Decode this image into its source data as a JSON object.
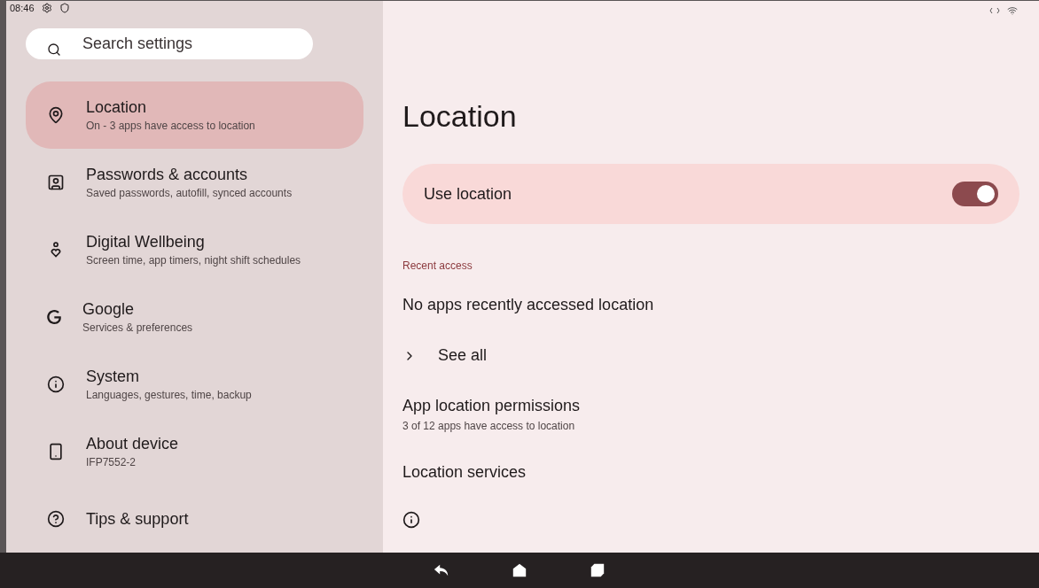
{
  "status_bar": {
    "time": "08:46"
  },
  "search": {
    "placeholder": "Search settings"
  },
  "sidebar": {
    "items": [
      {
        "kind": "location",
        "title": "Location",
        "subtitle": "On - 3 apps have access to location",
        "selected": true
      },
      {
        "kind": "account",
        "title": "Passwords & accounts",
        "subtitle": "Saved passwords, autofill, synced accounts",
        "selected": false
      },
      {
        "kind": "wellbeing",
        "title": "Digital Wellbeing",
        "subtitle": "Screen time, app timers, night shift schedules",
        "selected": false
      },
      {
        "kind": "google",
        "title": "Google",
        "subtitle": "Services & preferences",
        "selected": false
      },
      {
        "kind": "info",
        "title": "System",
        "subtitle": "Languages, gestures, time, backup",
        "selected": false
      },
      {
        "kind": "device",
        "title": "About device",
        "subtitle": "IFP7552-2",
        "selected": false
      },
      {
        "kind": "help",
        "title": "Tips & support",
        "selected": false
      }
    ]
  },
  "page": {
    "title": "Location",
    "use_location": {
      "label": "Use location",
      "on": true
    },
    "section_header": "Recent access",
    "recent_text": "No apps recently accessed location",
    "see_all": "See all",
    "permissions": {
      "title": "App location permissions",
      "subtitle": "3 of 12 apps have access to location"
    },
    "services": "Location services"
  }
}
